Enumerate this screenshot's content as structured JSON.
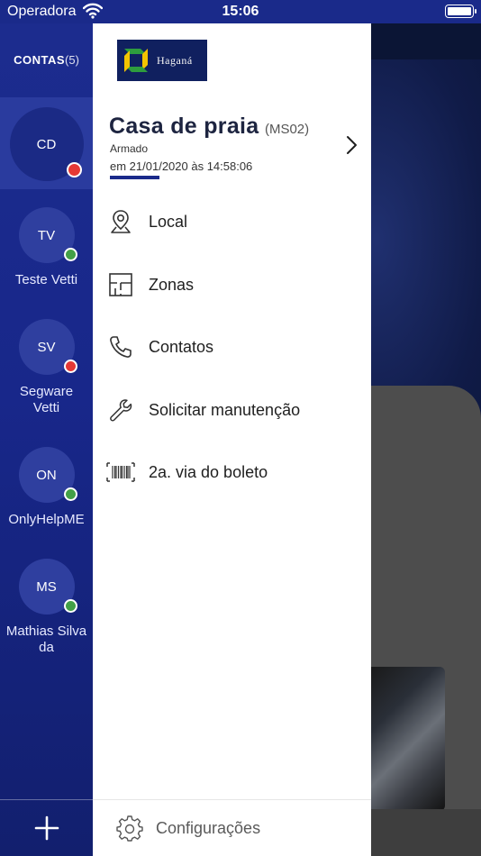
{
  "status_bar": {
    "carrier": "Operadora",
    "time": "15:06"
  },
  "accounts": {
    "title": "CONTAS",
    "count": "(5)",
    "items": [
      {
        "initials": "CD",
        "name": "",
        "status_color": "#e53935",
        "selected": true
      },
      {
        "initials": "TV",
        "name": "Teste Vetti",
        "status_color": "#43a047"
      },
      {
        "initials": "SV",
        "name": "Segware\nVetti",
        "status_color": "#e53935"
      },
      {
        "initials": "ON",
        "name": "OnlyHelpME",
        "status_color": "#43a047"
      },
      {
        "initials": "MS",
        "name": "Mathias Silva\nda",
        "status_color": "#43a047"
      }
    ],
    "add_icon": "plus-icon"
  },
  "drawer": {
    "logo_text": "Haganá",
    "site": {
      "name": "Casa de praia",
      "code": "(MS02)",
      "status": "Armado",
      "date": "em 21/01/2020 às 14:58:06"
    },
    "menu": [
      {
        "label": "Local",
        "icon": "map-pin-icon"
      },
      {
        "label": "Zonas",
        "icon": "floorplan-icon"
      },
      {
        "label": "Contatos",
        "icon": "phone-icon"
      },
      {
        "label": "Solicitar manutenção",
        "icon": "wrench-icon"
      },
      {
        "label": "2a. via do boleto",
        "icon": "barcode-icon"
      }
    ],
    "settings_label": "Configurações"
  },
  "colors": {
    "sidebar": "#1c2c8e",
    "accent": "#1a2a8a",
    "alarm_red": "#e53935",
    "ok_green": "#43a047"
  }
}
